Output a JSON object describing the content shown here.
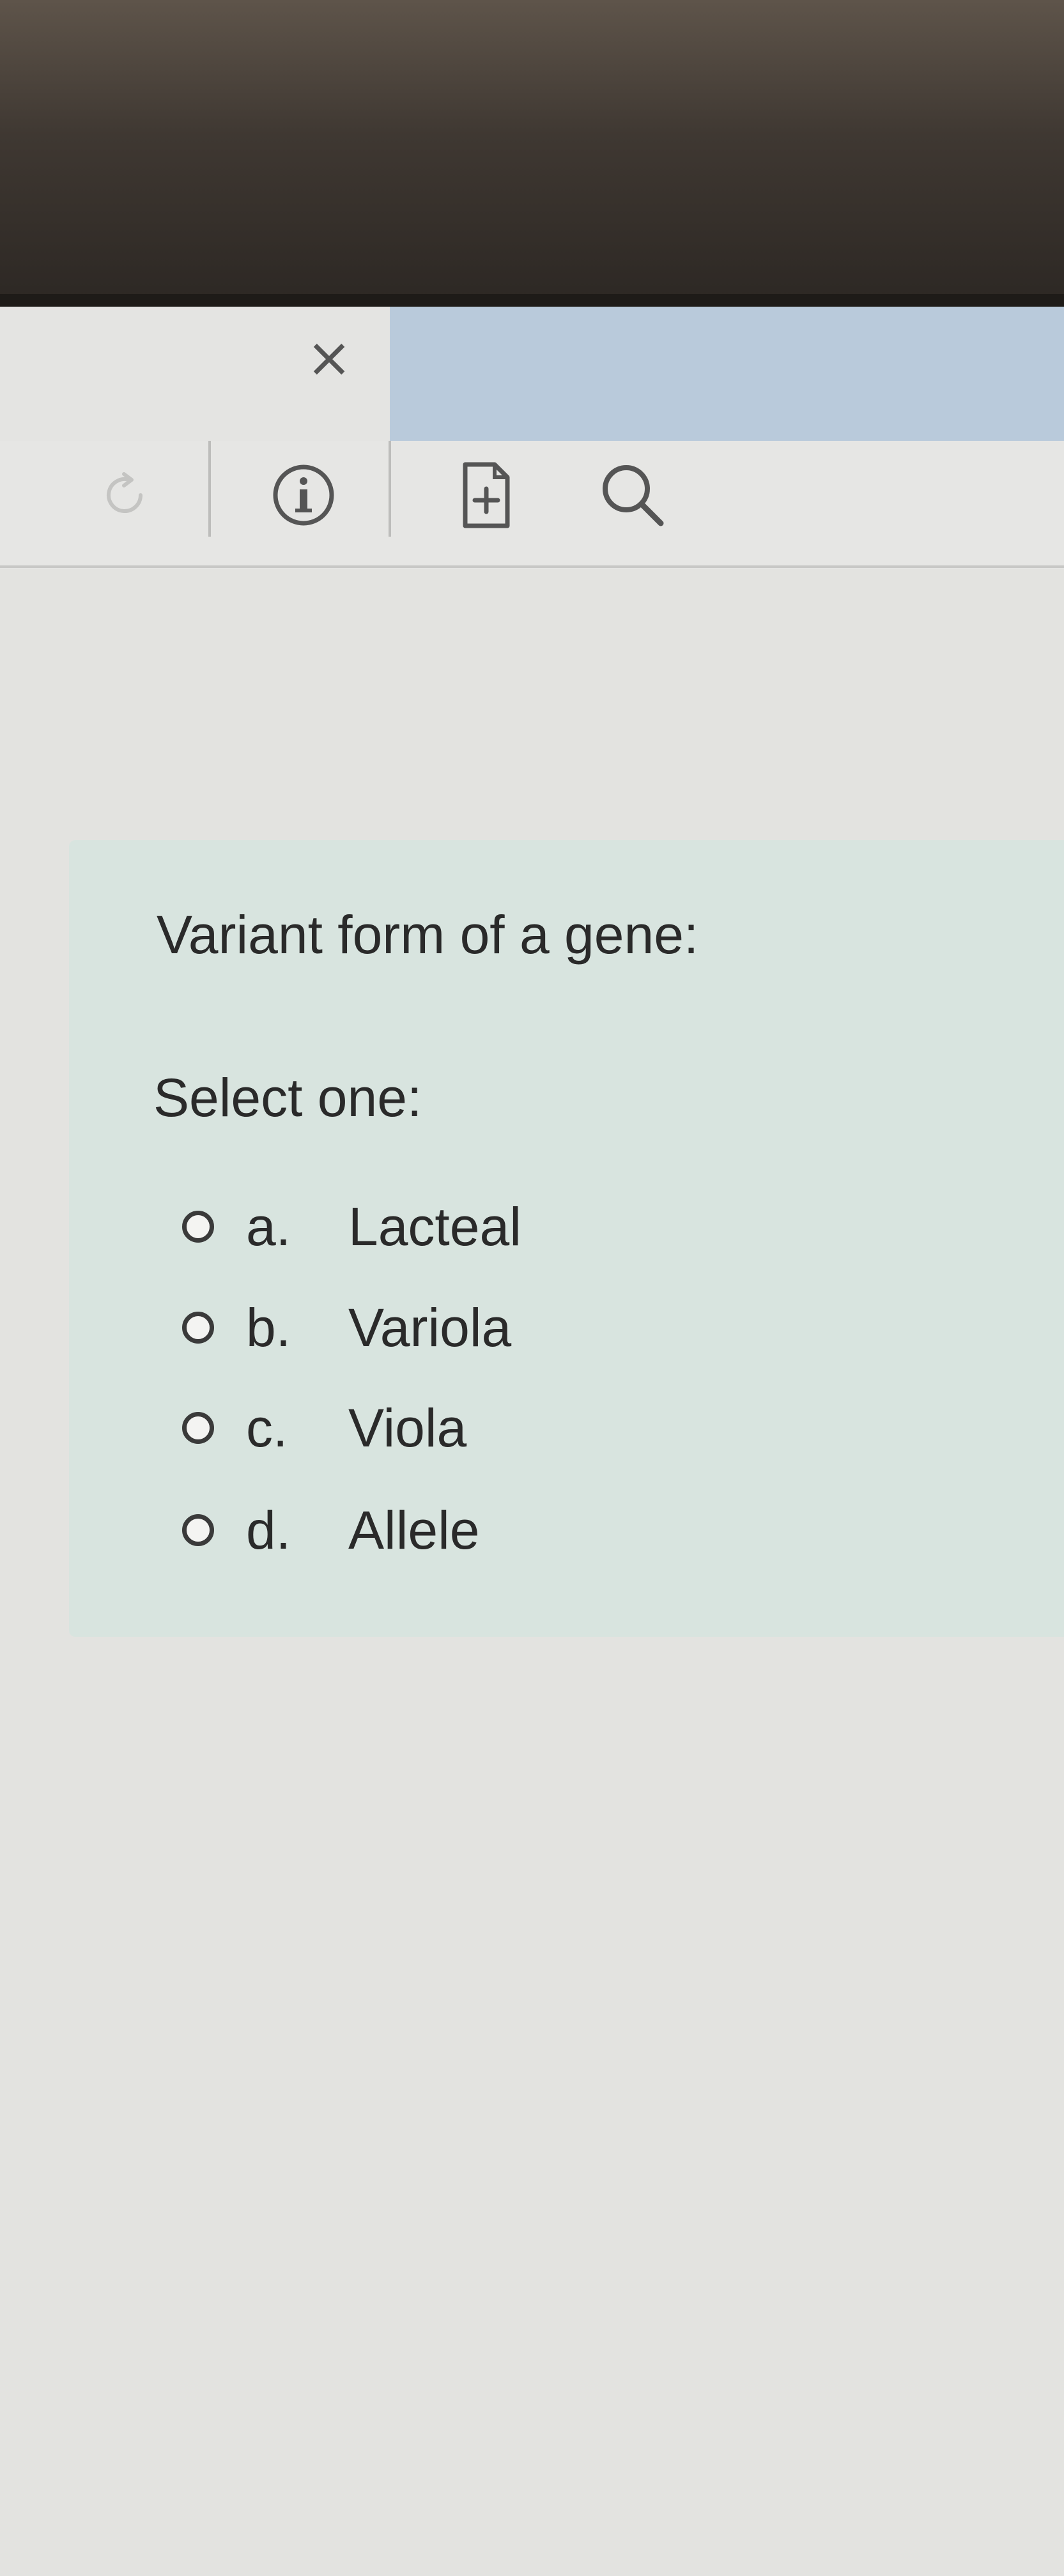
{
  "browser": {
    "close_tab_glyph": "×",
    "active_tab_color": "#b9cadb"
  },
  "toolbar": {
    "icons": [
      "reload-icon",
      "info-icon",
      "add-page-icon",
      "search-icon"
    ]
  },
  "question": {
    "text": "Variant form of a gene:",
    "prompt": "Select one:",
    "options": [
      {
        "letter": "a.",
        "label": "Lacteal"
      },
      {
        "letter": "b.",
        "label": "Variola"
      },
      {
        "letter": "c.",
        "label": "Viola"
      },
      {
        "letter": "d.",
        "label": "Allele"
      }
    ],
    "card_color": "#d8e4df"
  }
}
